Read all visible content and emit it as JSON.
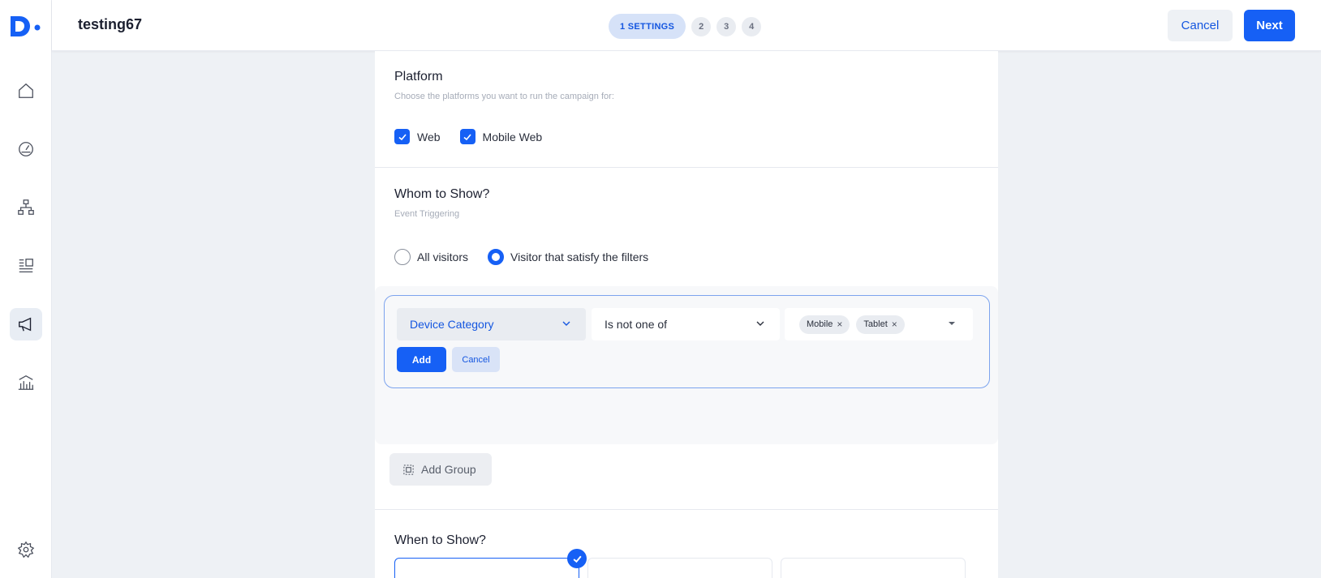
{
  "app": {
    "campaign_name": "testing67",
    "brand_color": "#1660f5"
  },
  "sidebar": {
    "items": [
      {
        "icon": "home-icon"
      },
      {
        "icon": "gauge-icon"
      },
      {
        "icon": "hierarchy-icon"
      },
      {
        "icon": "list-icon"
      },
      {
        "icon": "megaphone-icon",
        "active": true
      },
      {
        "icon": "bank-chart-icon"
      },
      {
        "icon": "gear-icon"
      }
    ]
  },
  "steps": {
    "current": "1 SETTINGS",
    "others": [
      "2",
      "3",
      "4"
    ]
  },
  "header": {
    "cancel_label": "Cancel",
    "next_label": "Next"
  },
  "platform": {
    "title": "Platform",
    "subtitle": "Choose the platforms you want to run the campaign for:",
    "options": [
      {
        "label": "Web",
        "checked": true
      },
      {
        "label": "Mobile Web",
        "checked": true
      }
    ]
  },
  "audience": {
    "title": "Whom to Show?",
    "subtitle": "Event Triggering",
    "options": [
      {
        "label": "All visitors",
        "selected": false
      },
      {
        "label": "Visitor that satisfy the filters",
        "selected": true
      }
    ],
    "filter": {
      "category": "Device Category",
      "operator": "Is not one of",
      "values": [
        "Mobile",
        "Tablet"
      ],
      "add_label": "Add",
      "cancel_label": "Cancel"
    },
    "add_group_label": "Add Group"
  },
  "when": {
    "title": "When to Show?"
  }
}
